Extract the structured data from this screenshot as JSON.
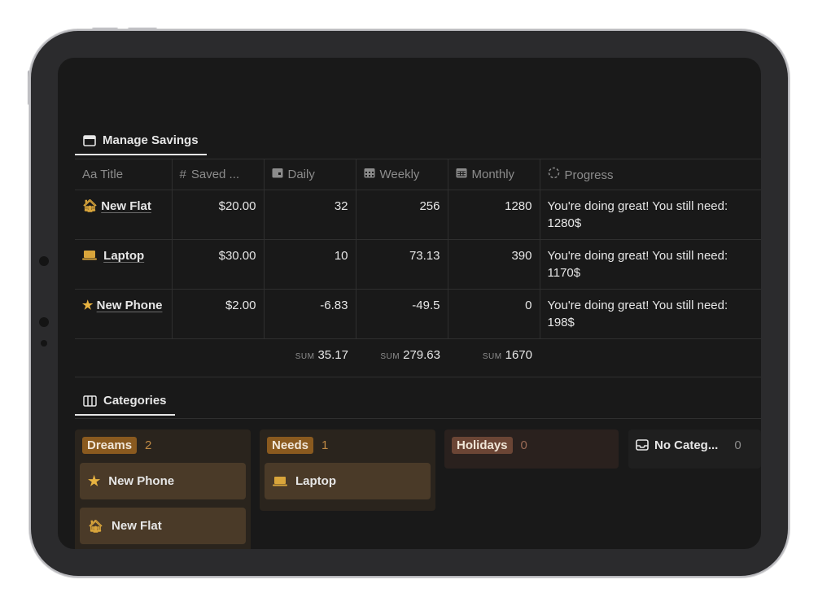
{
  "tabs": {
    "savings": "Manage Savings",
    "categories": "Categories"
  },
  "table": {
    "headers": {
      "title": "Title",
      "title_prefix": "Aa",
      "saved": "Saved ...",
      "daily": "Daily",
      "weekly": "Weekly",
      "monthly": "Monthly",
      "progress": "Progress"
    },
    "rows": [
      {
        "icon": "house-icon",
        "title": "New Flat",
        "saved": "$20.00",
        "daily": "32",
        "weekly": "256",
        "monthly": "1280",
        "progress": "You're doing great! You still need: 1280$"
      },
      {
        "icon": "laptop-icon",
        "title": "Laptop",
        "saved": "$30.00",
        "daily": "10",
        "weekly": "73.13",
        "monthly": "390",
        "progress": "You're doing great! You still need: 1170$"
      },
      {
        "icon": "star-icon",
        "title": "New Phone",
        "saved": "$2.00",
        "daily": "-6.83",
        "weekly": "-49.5",
        "monthly": "0",
        "progress": "You're doing great! You still need: 198$"
      }
    ],
    "sums": {
      "label": "SUM",
      "daily": "35.17",
      "weekly": "279.63",
      "monthly": "1670"
    }
  },
  "board": {
    "groups": [
      {
        "name": "Dreams",
        "count": "2",
        "cards": [
          {
            "icon": "star-icon",
            "title": "New Phone"
          },
          {
            "icon": "house-icon",
            "title": "New Flat"
          }
        ]
      },
      {
        "name": "Needs",
        "count": "1",
        "cards": [
          {
            "icon": "laptop-icon",
            "title": "Laptop"
          }
        ]
      },
      {
        "name": "Holidays",
        "count": "0",
        "cards": []
      },
      {
        "name": "No Categ...",
        "count": "0",
        "cards": []
      }
    ]
  },
  "colors": {
    "accent_gold": "#d9a53b",
    "dreams_badge": "#8a5a1f",
    "needs_badge": "#8a5a1f",
    "holidays_badge": "#6b4535"
  }
}
